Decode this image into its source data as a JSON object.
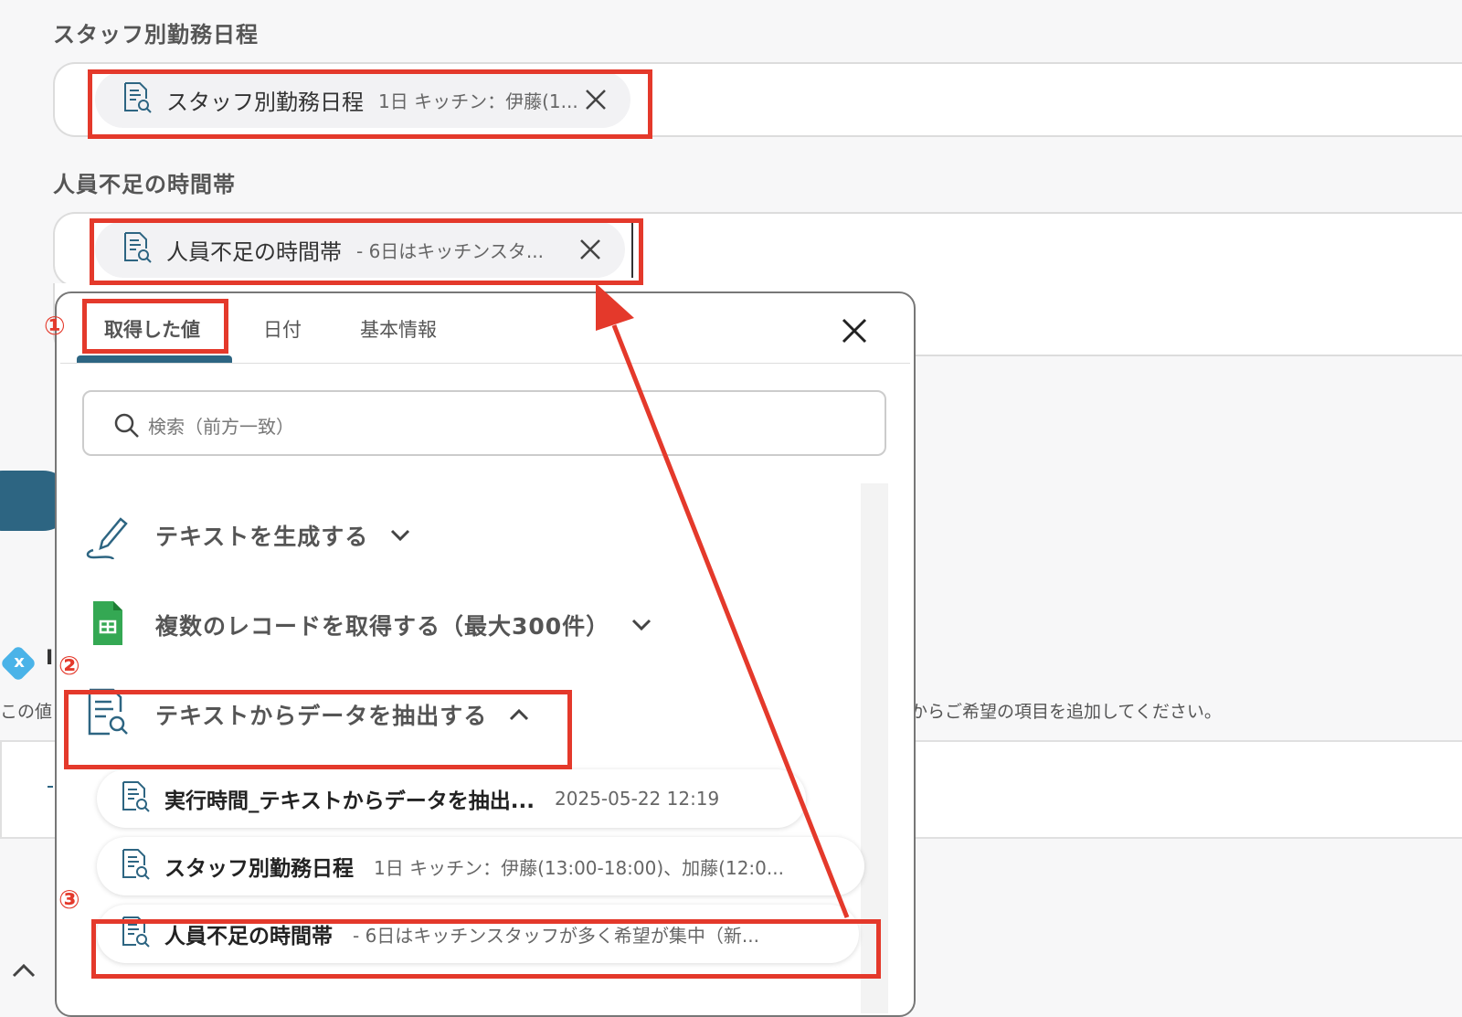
{
  "fields": [
    {
      "label": "スタッフ別勤務日程",
      "chip_title": "スタッフ別勤務日程",
      "chip_value": "1日 キッチン：伊藤(1..."
    },
    {
      "label": "人員不足の時間帯",
      "chip_title": "人員不足の時間帯",
      "chip_value": "- 6日はキッチンスタ..."
    }
  ],
  "background": {
    "partial_text_left": "この値",
    "partial_text_right": "からご希望の項目を追加してください。",
    "badge_letter": "x",
    "partial_heading": "I"
  },
  "popup": {
    "tabs": [
      "取得した値",
      "日付",
      "基本情報"
    ],
    "active_tab": 0,
    "search_placeholder": "検索（前方一致）",
    "sections": [
      {
        "label": "テキストを生成する",
        "icon": "pen-icon",
        "expanded": false
      },
      {
        "label": "複数のレコードを取得する（最大300件）",
        "icon": "spreadsheet-icon",
        "expanded": false
      },
      {
        "label": "テキストからデータを抽出する",
        "icon": "document-search-icon",
        "expanded": true
      }
    ],
    "items": [
      {
        "title": "実行時間_テキストからデータを抽出...",
        "value": "2025-05-22 12:19"
      },
      {
        "title": "スタッフ別勤務日程",
        "value": "1日 キッチン：伊藤(13:00-18:00)、加藤(12:0..."
      },
      {
        "title": "人員不足の時間帯",
        "value": "- 6日はキッチンスタッフが多く希望が集中（新..."
      }
    ]
  },
  "annotations": {
    "step1": "①",
    "step2": "②",
    "step3": "③"
  },
  "colors": {
    "highlight": "#e4392b",
    "accent": "#2d6582",
    "sheets_green": "#34a853"
  }
}
